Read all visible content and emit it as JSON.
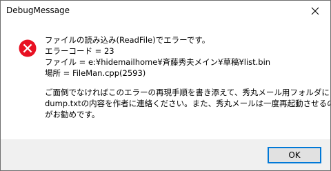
{
  "window": {
    "title": "DebugMessage"
  },
  "message": {
    "lines": [
      "ファイルの読み込み(ReadFile)でエラーです。",
      "エラーコード = 23",
      "ファイル = e:¥hidemailhome¥斉藤秀夫メイン¥草稿¥list.bin",
      "場所 = FileMan.cpp(2593)"
    ],
    "notice": [
      "ご面倒でなければこのエラーの再現手順を書き添えて、秀丸メール用フォルダにある",
      "dump.txtの内容を作者に連絡ください。また、秀丸メールは一度再起動させるの",
      "がお勧めです。"
    ]
  },
  "buttons": {
    "ok_label": "OK"
  },
  "icons": {
    "error": "error-icon",
    "close": "close-icon"
  },
  "colors": {
    "error_red": "#e81123",
    "focus_blue": "#0078d7",
    "footer_bg": "#f0f0f0"
  }
}
